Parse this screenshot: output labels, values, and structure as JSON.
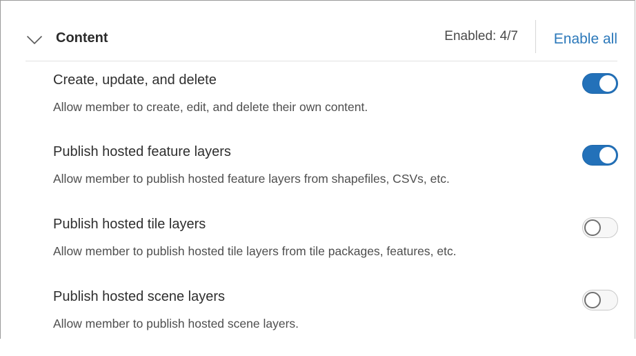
{
  "section": {
    "title": "Content",
    "expanded": true,
    "enabled_count": "Enabled: 4/7",
    "enable_all_label": "Enable all",
    "chevron_icon": "chevron-down-icon"
  },
  "privileges": [
    {
      "title": "Create, update, and delete",
      "description": "Allow member to create, edit, and delete their own content.",
      "enabled": true
    },
    {
      "title": "Publish hosted feature layers",
      "description": "Allow member to publish hosted feature layers from shapefiles, CSVs, etc.",
      "enabled": true
    },
    {
      "title": "Publish hosted tile layers",
      "description": "Allow member to publish hosted tile layers from tile packages, features, etc.",
      "enabled": false
    },
    {
      "title": "Publish hosted scene layers",
      "description": "Allow member to publish hosted scene layers.",
      "enabled": false
    }
  ],
  "colors": {
    "accent": "#2371b9",
    "link": "#2b78ba",
    "toggle_off_border": "#6f6f6f"
  }
}
